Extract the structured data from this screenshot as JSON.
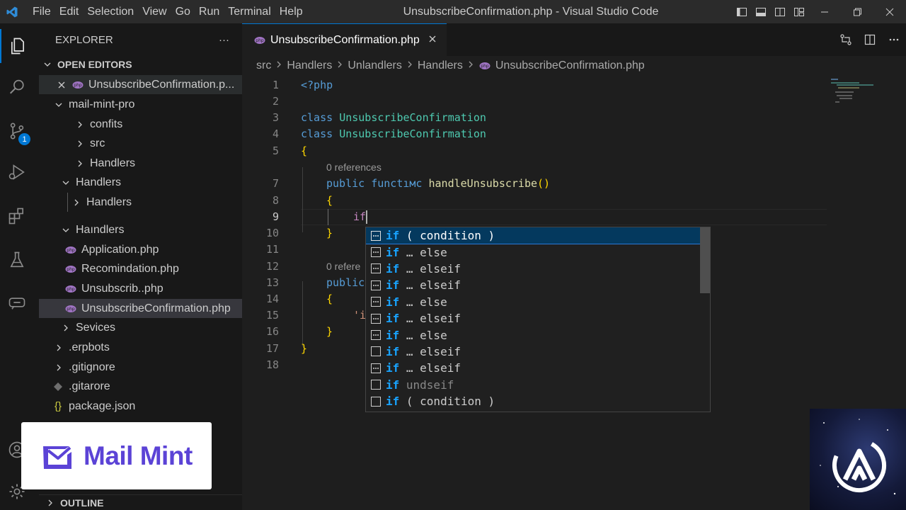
{
  "titlebar": {
    "menu": [
      "File",
      "Edit",
      "Selection",
      "View",
      "Go",
      "Run",
      "Terminal",
      "Help"
    ],
    "title": "UnsubscribeConfirmation.php - Visual Studio Code"
  },
  "activity": {
    "scm_badge": "1"
  },
  "sidebar": {
    "header": "EXPLORER",
    "more": "···",
    "open_editors_label": "OPEN EDITORS",
    "open_editor_file": "UnsubscribeConfirmation.p...",
    "tree": {
      "root": "mail-mint-pro",
      "confits": "confits",
      "src": "src",
      "handlers1": "Handlers",
      "handlers2": "Handlers",
      "handlers3": "Handlers",
      "handlers4": "Haındlers",
      "file1": "Application.php",
      "file2": "Recomindation.php",
      "file3": "Unsubscrib..php",
      "file4": "UnsubscribeConfirmation.php",
      "sevices": "Sevices",
      "erpbots": ".erpbots",
      "gitignore": ".gitignore",
      "gitarore": ".gitarore",
      "package": "package.json"
    },
    "outline_label": "OUTLINE"
  },
  "editor": {
    "tab_label": "UnsubscribeConfirmation.php",
    "breadcrumb": [
      "src",
      "Handlers",
      "Unlandlers",
      "Handlers",
      "UnsubscribeConfirmation.php"
    ],
    "line_numbers": [
      "1",
      "2",
      "3",
      "4",
      "5",
      "7",
      "8",
      "9",
      "10",
      "11",
      "12",
      "13",
      "14",
      "15",
      "16",
      "17",
      "18"
    ],
    "code": {
      "l1": "<?php",
      "l3_kw": "class",
      "l3_cls": "UnsubscribeConfirmation",
      "l4_kw": "class",
      "l4_cls": "UnsubscribeConfirmation",
      "l5": "{",
      "ref1": "0 references",
      "l7_kw1": "public",
      "l7_kw2": "functıмc",
      "l7_fn": "handleUnsubscribe",
      "l7_paren": "()",
      "l8": "{",
      "l9": "if",
      "l10": "}",
      "ref2": "0 refere",
      "l13": "public",
      "l14": "{",
      "l15": "'i",
      "l16": "}",
      "l17": "}"
    }
  },
  "suggest": {
    "items": [
      {
        "kw": "if",
        "rest": " ( condition )",
        "dim": false
      },
      {
        "kw": "if",
        "rest": " … else",
        "dim": false
      },
      {
        "kw": "if",
        "rest": " … elseif",
        "dim": false
      },
      {
        "kw": "if",
        "rest": " … elseif",
        "dim": false
      },
      {
        "kw": "if",
        "rest": " … else",
        "dim": false
      },
      {
        "kw": "if",
        "rest": " … elseif",
        "dim": false
      },
      {
        "kw": "if",
        "rest": " … else",
        "dim": false
      },
      {
        "kw": "if",
        "rest": " … elseif",
        "dim": false
      },
      {
        "kw": "if",
        "rest": " … elseif",
        "dim": false
      },
      {
        "kw": "if",
        "rest": " undseif",
        "dim": true
      },
      {
        "kw": "if",
        "rest": " ( condition )",
        "dim": false
      }
    ]
  },
  "overlay": {
    "brand": "Mail Mint"
  },
  "colors": {
    "accent": "#0078d4",
    "brand": "#5b43d6",
    "php_icon": "#a074c4"
  }
}
